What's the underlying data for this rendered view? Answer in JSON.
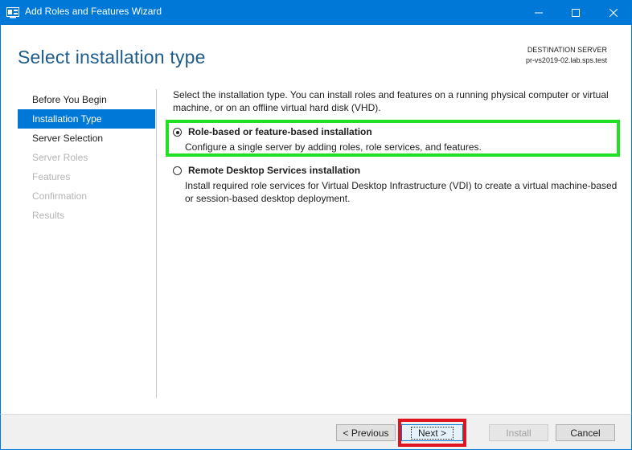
{
  "window": {
    "title": "Add Roles and Features Wizard",
    "controls": [
      "minimize-icon",
      "maximize-icon",
      "close-icon"
    ]
  },
  "header": {
    "page_title": "Select installation type",
    "destination_label": "DESTINATION SERVER",
    "destination_server": "pr-vs2019-02.lab.sps.test"
  },
  "nav": {
    "items": [
      {
        "label": "Before You Begin",
        "state": "normal"
      },
      {
        "label": "Installation Type",
        "state": "active"
      },
      {
        "label": "Server Selection",
        "state": "normal"
      },
      {
        "label": "Server Roles",
        "state": "disabled"
      },
      {
        "label": "Features",
        "state": "disabled"
      },
      {
        "label": "Confirmation",
        "state": "disabled"
      },
      {
        "label": "Results",
        "state": "disabled"
      }
    ]
  },
  "main": {
    "intro": "Select the installation type. You can install roles and features on a running physical computer or virtual machine, or on an offline virtual hard disk (VHD).",
    "options": [
      {
        "label": "Role-based or feature-based installation",
        "description": "Configure a single server by adding roles, role services, and features.",
        "selected": true
      },
      {
        "label": "Remote Desktop Services installation",
        "description": "Install required role services for Virtual Desktop Infrastructure (VDI) to create a virtual machine-based or session-based desktop deployment.",
        "selected": false
      }
    ]
  },
  "footer": {
    "previous_label": "< Previous",
    "next_label": "Next >",
    "install_label": "Install",
    "cancel_label": "Cancel"
  },
  "colors": {
    "accent": "#0078d7",
    "title_text": "#1e5d8b",
    "highlight_green": "#22e022",
    "highlight_red": "#e0141e"
  }
}
